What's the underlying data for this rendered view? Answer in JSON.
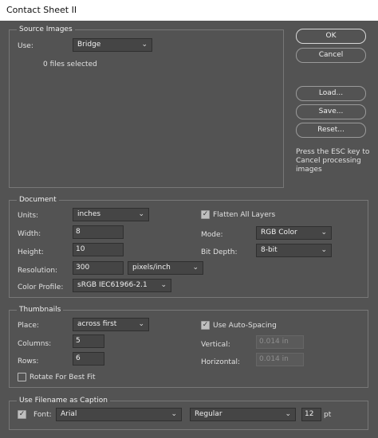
{
  "window": {
    "title": "Contact Sheet II"
  },
  "source_images": {
    "legend": "Source Images",
    "use_label": "Use:",
    "use_value": "Bridge",
    "files_status": "0 files selected"
  },
  "buttons": {
    "ok": "OK",
    "cancel": "Cancel",
    "load": "Load...",
    "save": "Save...",
    "reset": "Reset..."
  },
  "esc_note": [
    "Press the ESC key to",
    "Cancel processing",
    "images"
  ],
  "document": {
    "legend": "Document",
    "units_label": "Units:",
    "units_value": "inches",
    "width_label": "Width:",
    "width_value": "8",
    "height_label": "Height:",
    "height_value": "10",
    "resolution_label": "Resolution:",
    "resolution_value": "300",
    "resolution_unit": "pixels/inch",
    "color_profile_label": "Color Profile:",
    "color_profile_value": "sRGB IEC61966-2.1",
    "flatten_label": "Flatten All Layers",
    "flatten_checked": true,
    "mode_label": "Mode:",
    "mode_value": "RGB Color",
    "bit_depth_label": "Bit Depth:",
    "bit_depth_value": "8-bit"
  },
  "thumbnails": {
    "legend": "Thumbnails",
    "place_label": "Place:",
    "place_value": "across first",
    "columns_label": "Columns:",
    "columns_value": "5",
    "rows_label": "Rows:",
    "rows_value": "6",
    "rotate_label": "Rotate For Best Fit",
    "rotate_checked": false,
    "auto_spacing_label": "Use Auto-Spacing",
    "auto_spacing_checked": true,
    "vertical_label": "Vertical:",
    "vertical_value": "0.014 in",
    "horizontal_label": "Horizontal:",
    "horizontal_value": "0.014 in"
  },
  "caption": {
    "legend": "Use Filename as Caption",
    "font_label": "Font:",
    "font_checked": true,
    "font_value": "Arial",
    "style_value": "Regular",
    "size_value": "12",
    "size_unit": "pt"
  },
  "icons": {
    "dropdown": "chevron-down-icon",
    "check": "check-icon"
  },
  "colors": {
    "background": "#535353",
    "field": "#454545",
    "titlebar": "#ffffff"
  }
}
